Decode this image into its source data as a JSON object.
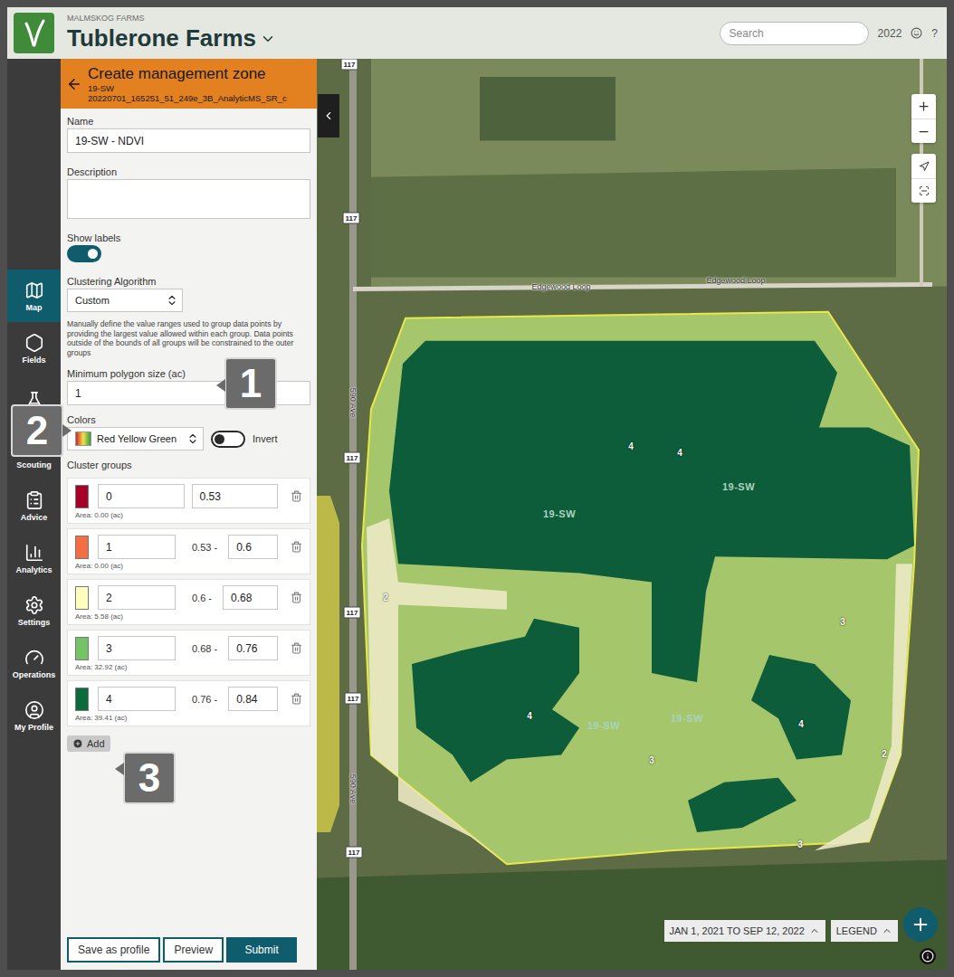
{
  "header": {
    "org": "MALMSKOG FARMS",
    "farm": "Tublerone Farms",
    "search": {
      "placeholder": "Search"
    },
    "year": "2022",
    "help": "?"
  },
  "nav": {
    "items": [
      {
        "label": "Map",
        "icon": "map",
        "selected": true
      },
      {
        "label": "Fields",
        "icon": "fields",
        "selected": false
      },
      {
        "icon": "lab",
        "selected": false
      },
      {
        "label": "Scouting",
        "icon": "scouting",
        "selected": false
      },
      {
        "label": "Advice",
        "icon": "advice",
        "selected": false
      },
      {
        "label": "Analytics",
        "icon": "analytics",
        "selected": false
      },
      {
        "label": "Settings",
        "icon": "settings",
        "selected": false
      },
      {
        "label": "Operations",
        "icon": "operations",
        "selected": false
      },
      {
        "label": "My Profile",
        "icon": "profile",
        "selected": false
      }
    ]
  },
  "panel": {
    "title": "Create management zone",
    "field": "19-SW",
    "source": "20220701_165251_51_249e_3B_AnalyticMS_SR_c",
    "name": {
      "label": "Name",
      "value": "19-SW - NDVI"
    },
    "description": {
      "label": "Description",
      "value": ""
    },
    "show_labels": {
      "label": "Show labels",
      "on": true
    },
    "algorithm": {
      "label": "Clustering Algorithm",
      "value": "Custom",
      "help": "Manually define the value ranges used to group data points by providing the largest value allowed within each group. Data points outside of the bounds of all groups will be constrained to the outer groups"
    },
    "min_polygon": {
      "label": "Minimum polygon size (ac)",
      "value": "1"
    },
    "colors": {
      "label": "Colors",
      "value": "Red Yellow Green"
    },
    "invert": {
      "label": "Invert",
      "on": false
    },
    "cluster_title": "Cluster groups",
    "cluster_groups": [
      {
        "kind": "open",
        "id": "0",
        "max": "0.53",
        "area": "Area: 0.00 (ac)",
        "color": "#a50026"
      },
      {
        "kind": "range",
        "id": "1",
        "range": "0.53 -",
        "max": "0.6",
        "area": "Area: 0.00 (ac)",
        "color": "#f46d43"
      },
      {
        "kind": "range",
        "id": "2",
        "range": "0.6 -",
        "max": "0.68",
        "area": "Area: 5.58 (ac)",
        "color": "#fefebd"
      },
      {
        "kind": "range",
        "id": "3",
        "range": "0.68 -",
        "max": "0.76",
        "area": "Area: 32.92 (ac)",
        "color": "#74c465"
      },
      {
        "kind": "range",
        "id": "4",
        "range": "0.76 -",
        "max": "0.84",
        "area": "Area: 39.41 (ac)",
        "color": "#0b6b3a"
      }
    ],
    "add": "Add",
    "buttons": [
      {
        "label": "Save as profile",
        "primary": false
      },
      {
        "label": "Preview",
        "primary": false
      },
      {
        "label": "Submit",
        "primary": true
      }
    ]
  },
  "map": {
    "road_shields": [
      "117",
      "117",
      "117",
      "117",
      "117",
      "117"
    ],
    "road_vertical": [
      "590 Ave",
      "590 Ave"
    ],
    "road_names": [
      "Edgewood Loop",
      "Edgewood Loop"
    ],
    "field_labels": [
      "19-SW",
      "19-SW",
      "19-SW",
      "19-SW"
    ],
    "zone_labels": [
      "4",
      "4",
      "4",
      "4",
      "3",
      "3",
      "3",
      "2",
      "2"
    ],
    "date_range": "JAN 1, 2021 TO SEP 12, 2022",
    "legend": "LEGEND"
  },
  "annotations": [
    "1",
    "2",
    "3"
  ]
}
